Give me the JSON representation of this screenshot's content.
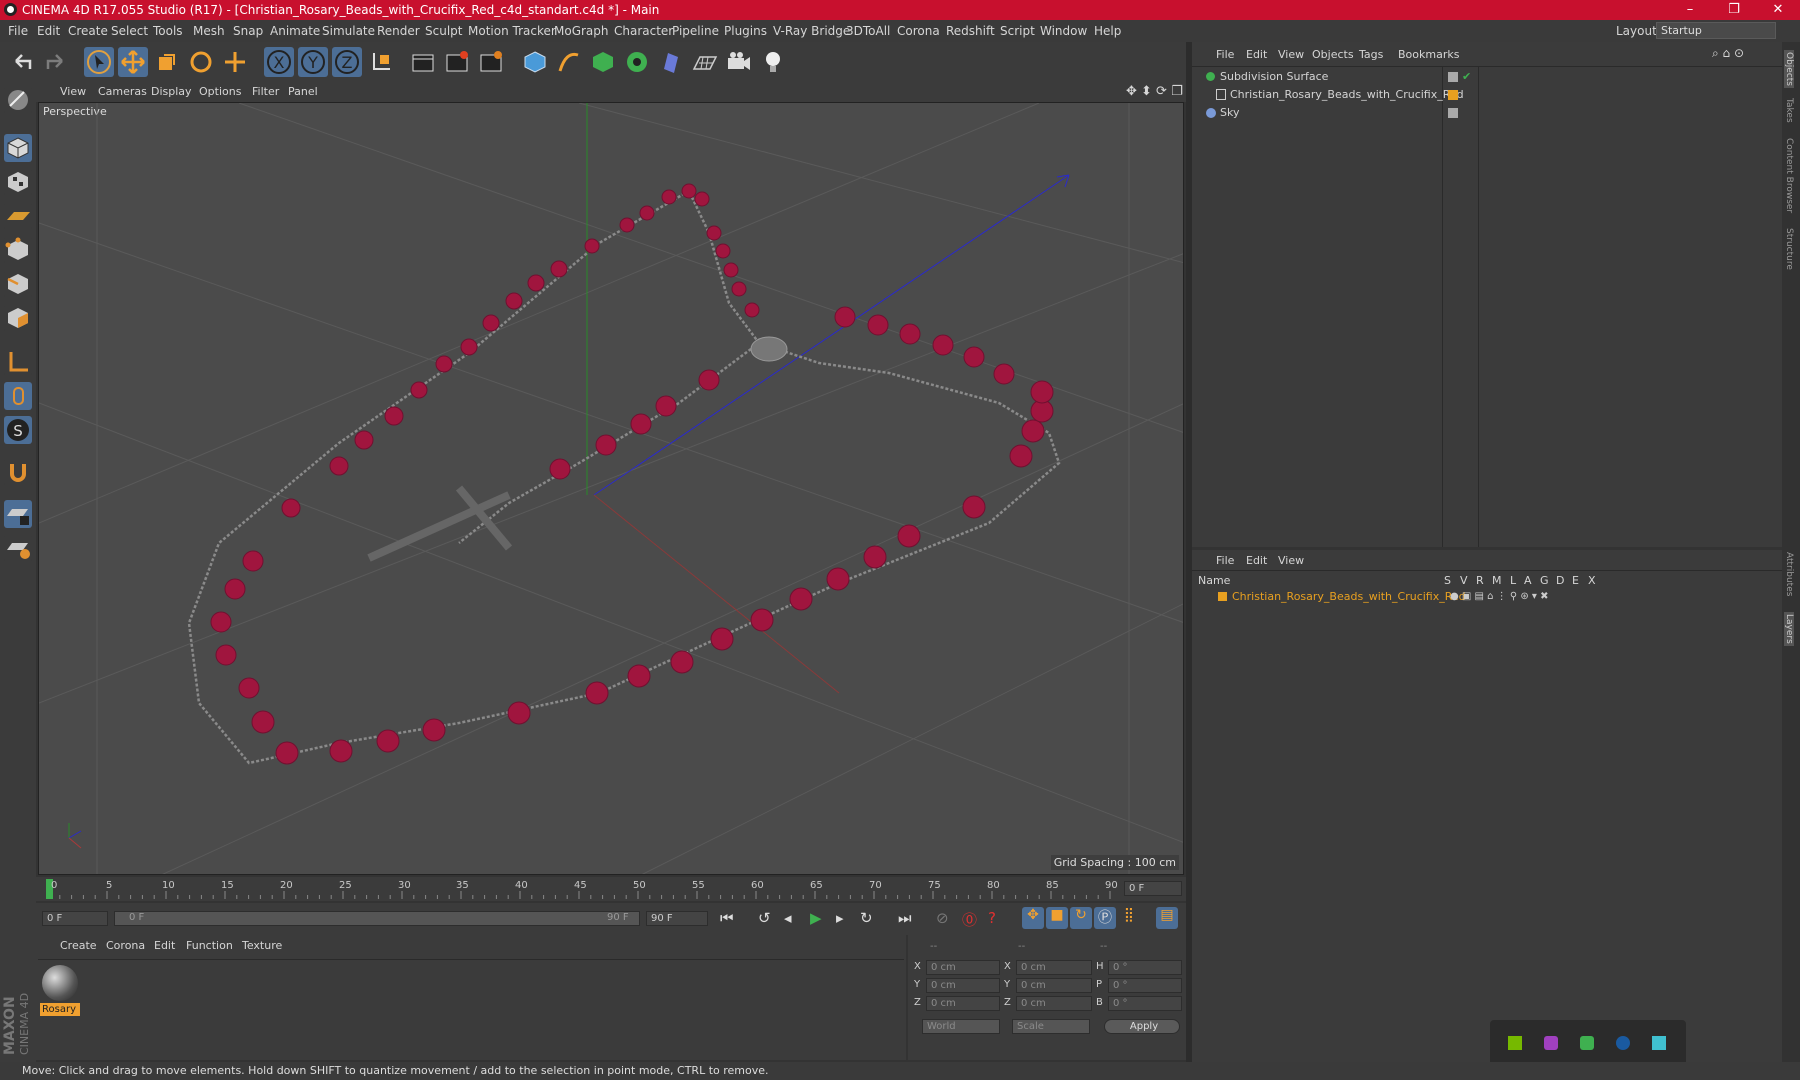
{
  "app": {
    "title": "CINEMA 4D R17.055 Studio (R17) - [Christian_Rosary_Beads_with_Crucifix_Red_c4d_standart.c4d *] - Main",
    "minimize": "–",
    "maximize": "❐",
    "close": "✕"
  },
  "menubar": {
    "items": [
      "File",
      "Edit",
      "Create",
      "Select",
      "Tools",
      "Mesh",
      "Snap",
      "Animate",
      "Simulate",
      "Render",
      "Sculpt",
      "Motion Tracker",
      "MoGraph",
      "Character",
      "Pipeline",
      "Plugins",
      "V-Ray Bridge",
      "3DToAll",
      "Corona",
      "Redshift",
      "Script",
      "Window",
      "Help"
    ],
    "layout_label": "Layout:",
    "layout_value": "Startup"
  },
  "viewport": {
    "menu": [
      "View",
      "Cameras",
      "Display",
      "Options",
      "Filter",
      "Panel"
    ],
    "label": "Perspective",
    "grid_spacing": "Grid Spacing : 100 cm"
  },
  "timeline": {
    "ticks": [
      "0",
      "5",
      "10",
      "15",
      "20",
      "25",
      "30",
      "35",
      "40",
      "45",
      "50",
      "55",
      "60",
      "65",
      "70",
      "75",
      "80",
      "85",
      "90"
    ],
    "current_frame": "0 F",
    "start_frame": "0 F",
    "slider_start": "0 F",
    "slider_end": "90 F",
    "end_frame": "90 F"
  },
  "materials": {
    "menu": [
      "Create",
      "Corona",
      "Edit",
      "Function",
      "Texture"
    ],
    "items": [
      {
        "name": "Rosary"
      }
    ]
  },
  "coordinates": {
    "header": [
      "--",
      "--",
      "--"
    ],
    "rows": [
      {
        "l1": "X",
        "v1": "0 cm",
        "l2": "X",
        "v2": "0 cm",
        "l3": "H",
        "v3": "0 °"
      },
      {
        "l1": "Y",
        "v1": "0 cm",
        "l2": "Y",
        "v2": "0 cm",
        "l3": "P",
        "v3": "0 °"
      },
      {
        "l1": "Z",
        "v1": "0 cm",
        "l2": "Z",
        "v2": "0 cm",
        "l3": "B",
        "v3": "0 °"
      }
    ],
    "world": "World",
    "scale": "Scale",
    "apply": "Apply"
  },
  "objects": {
    "menu": [
      "File",
      "Edit",
      "View",
      "Objects",
      "Tags",
      "Bookmarks"
    ],
    "items": [
      {
        "name": "Subdivision Surface"
      },
      {
        "name": "Christian_Rosary_Beads_with_Crucifix_Red"
      },
      {
        "name": "Sky"
      }
    ]
  },
  "layers": {
    "menu": [
      "File",
      "Edit",
      "View"
    ],
    "col_name": "Name",
    "cols": [
      "S",
      "V",
      "R",
      "M",
      "L",
      "A",
      "G",
      "D",
      "E",
      "X"
    ],
    "items": [
      {
        "name": "Christian_Rosary_Beads_with_Crucifix_Red"
      }
    ]
  },
  "sidetabs": [
    "Objects",
    "Takes",
    "Content Browser",
    "Structure",
    "Attributes",
    "Layers"
  ],
  "status": "Move: Click and drag to move elements. Hold down SHIFT to quantize movement / add to the selection in point mode, CTRL to remove.",
  "colors": {
    "titlebar": "#c8102e",
    "accent": "#4c6e96",
    "bead": "#a0153e",
    "layer": "#e8a020"
  }
}
